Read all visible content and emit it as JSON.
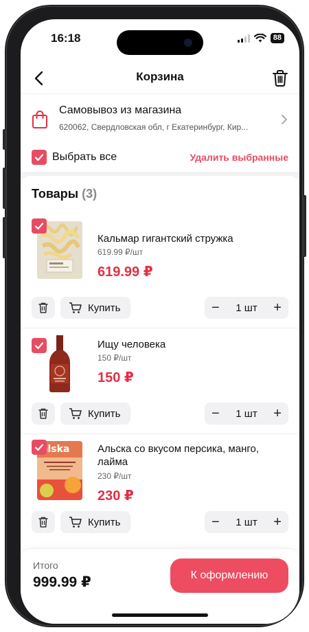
{
  "status": {
    "time": "16:18",
    "battery": "88"
  },
  "header": {
    "title": "Корзина"
  },
  "pickup": {
    "title": "Самовывоз из магазина",
    "address": "620062, Свердловская обл, г Екатеринбург, Кир..."
  },
  "select_all": {
    "label": "Выбрать все",
    "delete_selected": "Удалить выбранные"
  },
  "section": {
    "title": "Товары",
    "count": "(3)"
  },
  "items": [
    {
      "name": "Кальмар гигантский стружка",
      "unit_price": "619.99 ₽/шт",
      "price": "619.99 ₽",
      "buy_label": "Купить",
      "qty": "1 шт"
    },
    {
      "name": "Ищу человека",
      "unit_price": "150 ₽/шт",
      "price": "150 ₽",
      "buy_label": "Купить",
      "qty": "1 шт"
    },
    {
      "name": "Альска со вкусом персика, манго, лайма",
      "unit_price": "230 ₽/шт",
      "price": "230 ₽",
      "buy_label": "Купить",
      "qty": "1 шт",
      "image_text": "alska"
    }
  ],
  "footer": {
    "total_label": "Итого",
    "total_value": "999.99 ₽",
    "checkout_label": "К оформлению"
  },
  "colors": {
    "accent": "#e84c63",
    "price": "#e32f45",
    "checkout_bg": "#ee4c61"
  }
}
